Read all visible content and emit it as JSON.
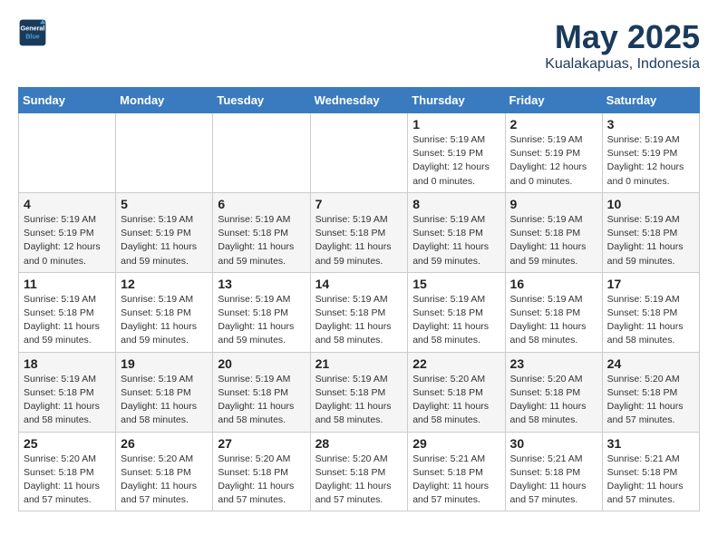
{
  "logo": {
    "line1": "General",
    "line2": "Blue"
  },
  "title": "May 2025",
  "subtitle": "Kualakapuas, Indonesia",
  "header_days": [
    "Sunday",
    "Monday",
    "Tuesday",
    "Wednesday",
    "Thursday",
    "Friday",
    "Saturday"
  ],
  "weeks": [
    [
      {
        "day": "",
        "info": ""
      },
      {
        "day": "",
        "info": ""
      },
      {
        "day": "",
        "info": ""
      },
      {
        "day": "",
        "info": ""
      },
      {
        "day": "1",
        "info": "Sunrise: 5:19 AM\nSunset: 5:19 PM\nDaylight: 12 hours\nand 0 minutes."
      },
      {
        "day": "2",
        "info": "Sunrise: 5:19 AM\nSunset: 5:19 PM\nDaylight: 12 hours\nand 0 minutes."
      },
      {
        "day": "3",
        "info": "Sunrise: 5:19 AM\nSunset: 5:19 PM\nDaylight: 12 hours\nand 0 minutes."
      }
    ],
    [
      {
        "day": "4",
        "info": "Sunrise: 5:19 AM\nSunset: 5:19 PM\nDaylight: 12 hours\nand 0 minutes."
      },
      {
        "day": "5",
        "info": "Sunrise: 5:19 AM\nSunset: 5:19 PM\nDaylight: 11 hours\nand 59 minutes."
      },
      {
        "day": "6",
        "info": "Sunrise: 5:19 AM\nSunset: 5:18 PM\nDaylight: 11 hours\nand 59 minutes."
      },
      {
        "day": "7",
        "info": "Sunrise: 5:19 AM\nSunset: 5:18 PM\nDaylight: 11 hours\nand 59 minutes."
      },
      {
        "day": "8",
        "info": "Sunrise: 5:19 AM\nSunset: 5:18 PM\nDaylight: 11 hours\nand 59 minutes."
      },
      {
        "day": "9",
        "info": "Sunrise: 5:19 AM\nSunset: 5:18 PM\nDaylight: 11 hours\nand 59 minutes."
      },
      {
        "day": "10",
        "info": "Sunrise: 5:19 AM\nSunset: 5:18 PM\nDaylight: 11 hours\nand 59 minutes."
      }
    ],
    [
      {
        "day": "11",
        "info": "Sunrise: 5:19 AM\nSunset: 5:18 PM\nDaylight: 11 hours\nand 59 minutes."
      },
      {
        "day": "12",
        "info": "Sunrise: 5:19 AM\nSunset: 5:18 PM\nDaylight: 11 hours\nand 59 minutes."
      },
      {
        "day": "13",
        "info": "Sunrise: 5:19 AM\nSunset: 5:18 PM\nDaylight: 11 hours\nand 59 minutes."
      },
      {
        "day": "14",
        "info": "Sunrise: 5:19 AM\nSunset: 5:18 PM\nDaylight: 11 hours\nand 58 minutes."
      },
      {
        "day": "15",
        "info": "Sunrise: 5:19 AM\nSunset: 5:18 PM\nDaylight: 11 hours\nand 58 minutes."
      },
      {
        "day": "16",
        "info": "Sunrise: 5:19 AM\nSunset: 5:18 PM\nDaylight: 11 hours\nand 58 minutes."
      },
      {
        "day": "17",
        "info": "Sunrise: 5:19 AM\nSunset: 5:18 PM\nDaylight: 11 hours\nand 58 minutes."
      }
    ],
    [
      {
        "day": "18",
        "info": "Sunrise: 5:19 AM\nSunset: 5:18 PM\nDaylight: 11 hours\nand 58 minutes."
      },
      {
        "day": "19",
        "info": "Sunrise: 5:19 AM\nSunset: 5:18 PM\nDaylight: 11 hours\nand 58 minutes."
      },
      {
        "day": "20",
        "info": "Sunrise: 5:19 AM\nSunset: 5:18 PM\nDaylight: 11 hours\nand 58 minutes."
      },
      {
        "day": "21",
        "info": "Sunrise: 5:19 AM\nSunset: 5:18 PM\nDaylight: 11 hours\nand 58 minutes."
      },
      {
        "day": "22",
        "info": "Sunrise: 5:20 AM\nSunset: 5:18 PM\nDaylight: 11 hours\nand 58 minutes."
      },
      {
        "day": "23",
        "info": "Sunrise: 5:20 AM\nSunset: 5:18 PM\nDaylight: 11 hours\nand 58 minutes."
      },
      {
        "day": "24",
        "info": "Sunrise: 5:20 AM\nSunset: 5:18 PM\nDaylight: 11 hours\nand 57 minutes."
      }
    ],
    [
      {
        "day": "25",
        "info": "Sunrise: 5:20 AM\nSunset: 5:18 PM\nDaylight: 11 hours\nand 57 minutes."
      },
      {
        "day": "26",
        "info": "Sunrise: 5:20 AM\nSunset: 5:18 PM\nDaylight: 11 hours\nand 57 minutes."
      },
      {
        "day": "27",
        "info": "Sunrise: 5:20 AM\nSunset: 5:18 PM\nDaylight: 11 hours\nand 57 minutes."
      },
      {
        "day": "28",
        "info": "Sunrise: 5:20 AM\nSunset: 5:18 PM\nDaylight: 11 hours\nand 57 minutes."
      },
      {
        "day": "29",
        "info": "Sunrise: 5:21 AM\nSunset: 5:18 PM\nDaylight: 11 hours\nand 57 minutes."
      },
      {
        "day": "30",
        "info": "Sunrise: 5:21 AM\nSunset: 5:18 PM\nDaylight: 11 hours\nand 57 minutes."
      },
      {
        "day": "31",
        "info": "Sunrise: 5:21 AM\nSunset: 5:18 PM\nDaylight: 11 hours\nand 57 minutes."
      }
    ]
  ]
}
